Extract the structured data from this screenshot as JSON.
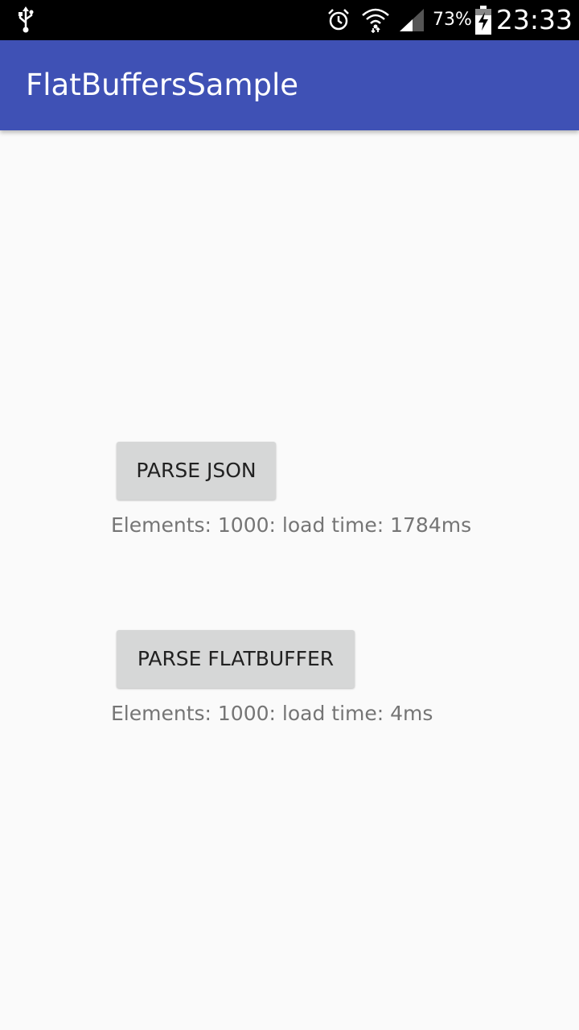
{
  "status_bar": {
    "usb_icon": "usb-icon",
    "alarm_icon": "alarm-icon",
    "wifi_icon": "wifi-icon",
    "signal_icon": "cell-signal-icon",
    "battery_percent": "73%",
    "battery_icon": "battery-charging-icon",
    "clock": "23:33"
  },
  "app_bar": {
    "title": "FlatBuffersSample",
    "color": "#3f51b5"
  },
  "main": {
    "json_button_label": "PARSE JSON",
    "json_result": "Elements: 1000: load time: 1784ms",
    "flatbuffer_button_label": "PARSE FLATBUFFER",
    "flatbuffer_result": "Elements: 1000: load time: 4ms"
  }
}
